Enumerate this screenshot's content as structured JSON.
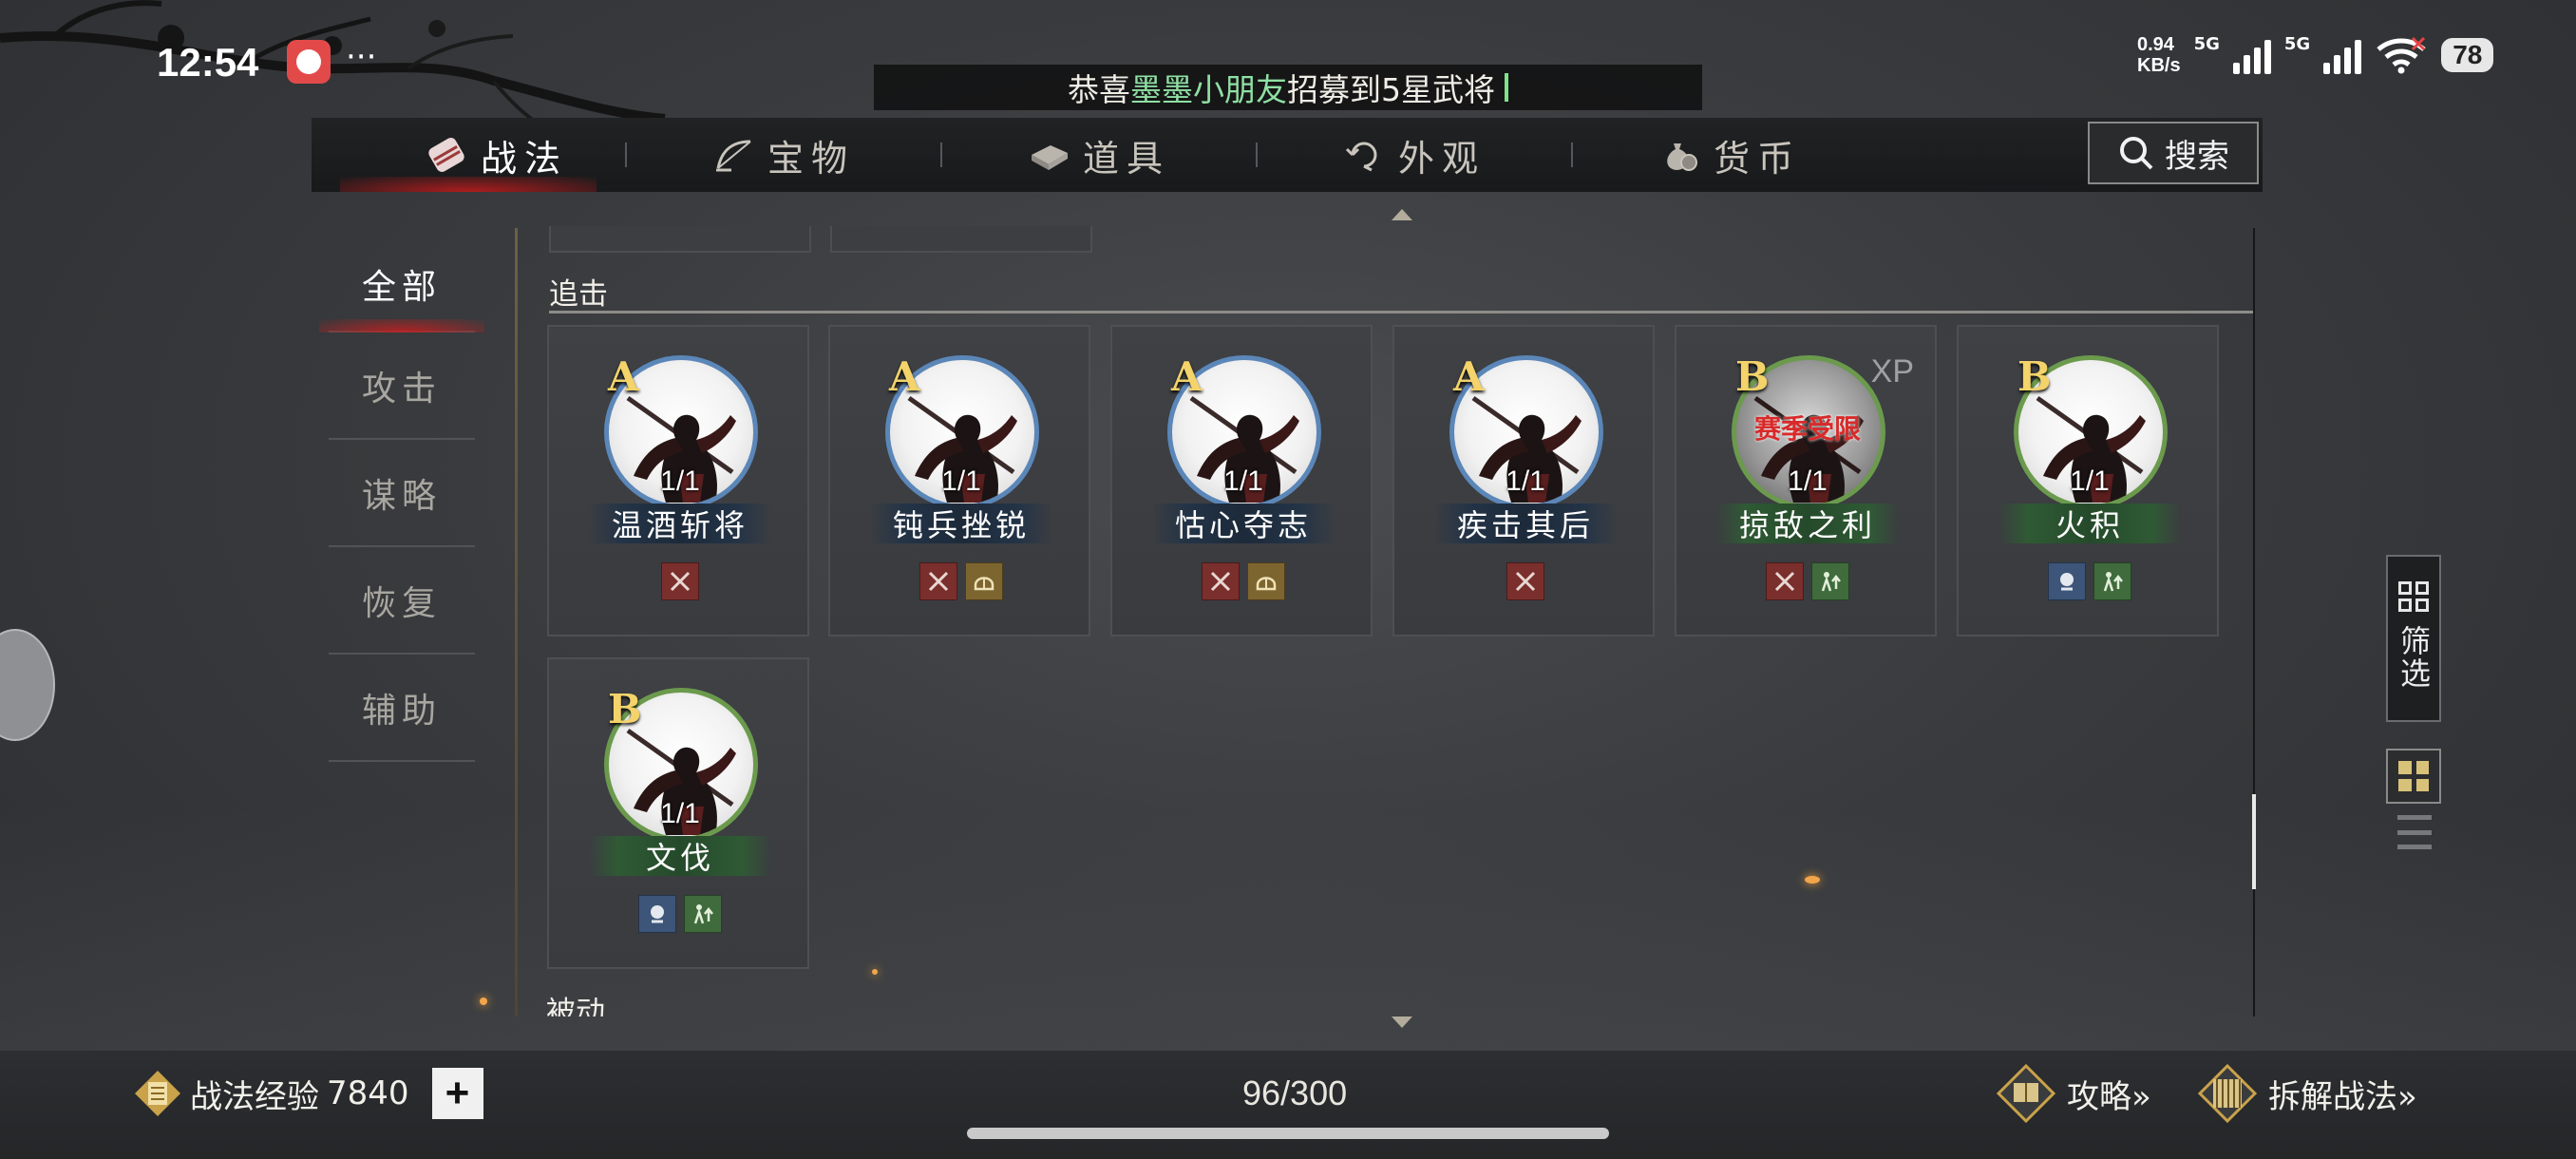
{
  "status_bar": {
    "time": "12:54",
    "net_speed_value": "0.94",
    "net_speed_unit": "KB/s",
    "signal1_label": "5G",
    "signal2_label": "5G",
    "battery": "78"
  },
  "ticker": {
    "prefix": "恭喜",
    "player": "墨墨小朋友",
    "suffix": "招募到5星武将"
  },
  "top_nav": {
    "tabs": [
      {
        "label": "战法",
        "icon": "scroll-bundle-icon",
        "active": true
      },
      {
        "label": "宝物",
        "icon": "bow-icon",
        "active": false
      },
      {
        "label": "道具",
        "icon": "book-icon",
        "active": false
      },
      {
        "label": "外观",
        "icon": "refresh-swirl-icon",
        "active": false
      },
      {
        "label": "货币",
        "icon": "coin-bag-icon",
        "active": false
      }
    ],
    "search_label": "搜索"
  },
  "categories": [
    {
      "label": "全部",
      "active": true
    },
    {
      "label": "攻击",
      "active": false
    },
    {
      "label": "谋略",
      "active": false
    },
    {
      "label": "恢复",
      "active": false
    },
    {
      "label": "辅助",
      "active": false
    }
  ],
  "section_title": "追击",
  "next_section_title": "被动",
  "cards": [
    {
      "grade": "A",
      "count": "1/1",
      "name": "温酒斩将",
      "ring": "blue",
      "tags": [
        "attack"
      ]
    },
    {
      "grade": "A",
      "count": "1/1",
      "name": "钝兵挫锐",
      "ring": "blue",
      "tags": [
        "attack",
        "defense"
      ]
    },
    {
      "grade": "A",
      "count": "1/1",
      "name": "怙心夺志",
      "ring": "blue",
      "tags": [
        "attack",
        "defense"
      ]
    },
    {
      "grade": "A",
      "count": "1/1",
      "name": "疾击其后",
      "ring": "blue",
      "tags": [
        "attack"
      ]
    },
    {
      "grade": "B",
      "count": "1/1",
      "name": "掠敌之利",
      "ring": "green",
      "tags": [
        "attack",
        "buff"
      ],
      "xp": "XP",
      "locked_text": "赛季受限"
    },
    {
      "grade": "B",
      "count": "1/1",
      "name": "火积",
      "ring": "green",
      "tags": [
        "strategy",
        "buff"
      ]
    },
    {
      "grade": "B",
      "count": "1/1",
      "name": "文伐",
      "ring": "green",
      "tags": [
        "strategy",
        "buff"
      ]
    }
  ],
  "filter_label": "筛选",
  "bottom": {
    "exp_label": "战法经验",
    "exp_value": "7840",
    "plus": "+",
    "capacity": "96/300",
    "guide_label": "攻略»",
    "dismantle_label": "拆解战法»"
  },
  "colors": {
    "grade_gold": "#f3d36a",
    "ring_blue": "#5b86b8",
    "ring_green": "#6b9a4d",
    "highlight_green": "#8fe0a4",
    "active_red": "#c81e1e"
  }
}
